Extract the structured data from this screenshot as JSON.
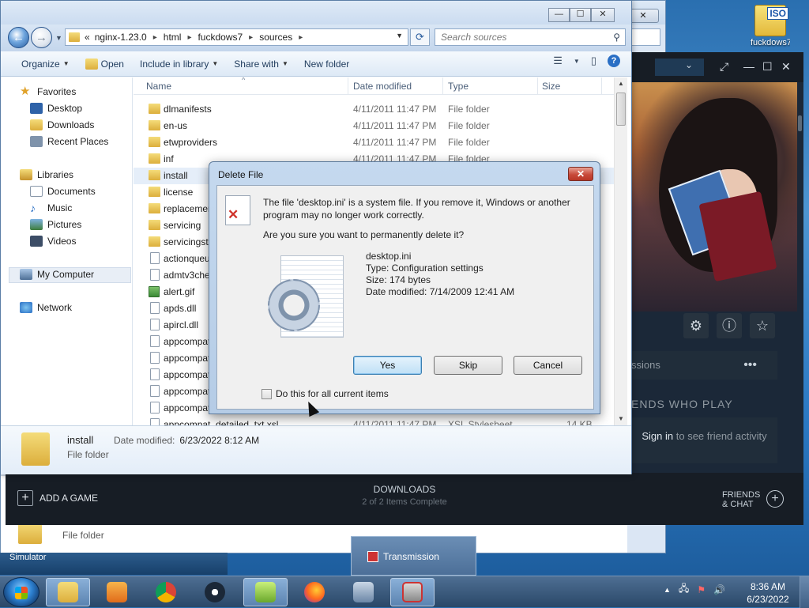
{
  "desktop": {
    "iso_label": "ISO",
    "iso_caption": "fuckdows7"
  },
  "explorer_back": {
    "close": "✕",
    "detail_type": "File folder"
  },
  "steam": {
    "wctl_ext": "⤢",
    "wctl_min": "—",
    "wctl_max": "☐",
    "wctl_close": "✕",
    "dropdown_arrow": "⌄",
    "icon_gear": "⚙",
    "icon_info": "ⓘ",
    "icon_star": "☆",
    "sessions": "ssions",
    "dots": "•••",
    "friends_heading": "ENDS WHO PLAY",
    "signin_link": "Sign in",
    "signin_rest": "to see friend activity",
    "add_game": "ADD A GAME",
    "add_plus": "+",
    "downloads": "DOWNLOADS",
    "downloads_status": "2 of 2 Items Complete",
    "friends_chat_1": "FRIENDS",
    "friends_chat_2": "& CHAT",
    "friends_plus": "+"
  },
  "explorer": {
    "min": "—",
    "max": "☐",
    "close": "✕",
    "back_arrow": "←",
    "forward_arrow": "→",
    "nav_dropdown": "▼",
    "crumbs": [
      "«",
      "nginx-1.23.0",
      "html",
      "fuckdows7",
      "sources"
    ],
    "crumb_sep": "▸",
    "address_dropdown": "▼",
    "refresh": "⟳",
    "search_placeholder": "Search sources",
    "search_icon": "⚲",
    "toolbar": {
      "organize": "Organize",
      "open": "Open",
      "include": "Include in library",
      "share": "Share with",
      "newfolder": "New folder",
      "dd": "▼"
    },
    "view_icon": "☰",
    "view_dd": "▼",
    "preview_icon": "▯",
    "help": "?",
    "nav": {
      "favorites": "Favorites",
      "desktop": "Desktop",
      "downloads": "Downloads",
      "recent": "Recent Places",
      "libraries": "Libraries",
      "documents": "Documents",
      "music": "Music",
      "pictures": "Pictures",
      "videos": "Videos",
      "computer": "My Computer",
      "network": "Network"
    },
    "columns": {
      "name": "Name",
      "date": "Date modified",
      "type": "Type",
      "size": "Size",
      "sort_arrow": "^"
    },
    "files": [
      {
        "name": "dlmanifests",
        "date": "4/11/2011 11:47 PM",
        "type": "File folder",
        "size": ""
      },
      {
        "name": "en-us",
        "date": "4/11/2011 11:47 PM",
        "type": "File folder",
        "size": ""
      },
      {
        "name": "etwproviders",
        "date": "4/11/2011 11:47 PM",
        "type": "File folder",
        "size": ""
      },
      {
        "name": "inf",
        "date": "4/11/2011 11:47 PM",
        "type": "File folder",
        "size": ""
      },
      {
        "name": "install",
        "date": "",
        "type": "",
        "size": ""
      },
      {
        "name": "license",
        "date": "",
        "type": "",
        "size": ""
      },
      {
        "name": "replacemer",
        "date": "",
        "type": "",
        "size": ""
      },
      {
        "name": "servicing",
        "date": "",
        "type": "",
        "size": ""
      },
      {
        "name": "servicingsta",
        "date": "",
        "type": "",
        "size": ""
      },
      {
        "name": "actionqueu",
        "date": "",
        "type": "",
        "size": ""
      },
      {
        "name": "admtv3che",
        "date": "",
        "type": "",
        "size": ""
      },
      {
        "name": "alert.gif",
        "date": "",
        "type": "",
        "size": ""
      },
      {
        "name": "apds.dll",
        "date": "",
        "type": "",
        "size": ""
      },
      {
        "name": "apircl.dll",
        "date": "",
        "type": "",
        "size": ""
      },
      {
        "name": "appcompat",
        "date": "",
        "type": "",
        "size": ""
      },
      {
        "name": "appcompat",
        "date": "",
        "type": "",
        "size": ""
      },
      {
        "name": "appcompat",
        "date": "",
        "type": "",
        "size": ""
      },
      {
        "name": "appcompat",
        "date": "",
        "type": "",
        "size": ""
      },
      {
        "name": "appcompat",
        "date": "",
        "type": "",
        "size": ""
      },
      {
        "name": "appcompat_detailed_txt.xsl",
        "date": "4/11/2011 11:47 PM",
        "type": "XSL Stylesheet",
        "size": "14 KB"
      }
    ],
    "scroll_up": "▲",
    "scroll_down": "▼",
    "details": {
      "name": "install",
      "date_label": "Date modified:",
      "date": "6/23/2022 8:12 AM",
      "type": "File folder"
    }
  },
  "dialog": {
    "title": "Delete File",
    "close": "✕",
    "message": "The file 'desktop.ini' is a system file. If you remove it, Windows or another program may no longer work correctly.",
    "question": "Are you sure you want to permanently delete it?",
    "warn_glyph": "✕",
    "file_name": "desktop.ini",
    "file_type": "Type: Configuration settings",
    "file_size": "Size: 174 bytes",
    "file_date": "Date modified: 7/14/2009 12:41 AM",
    "yes": "Yes",
    "skip": "Skip",
    "cancel": "Cancel",
    "checkbox": "Do this for all current items"
  },
  "taskbar": {
    "simulator": "Simulator",
    "transmission": "Transmission",
    "tray_up": "▲",
    "time": "8:36 AM",
    "date": "6/23/2022"
  }
}
